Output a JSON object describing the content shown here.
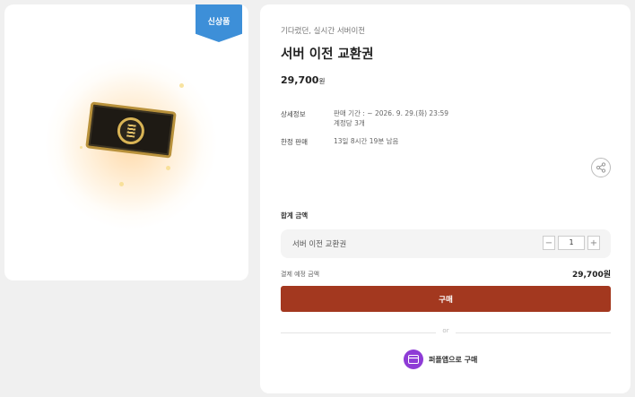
{
  "badge": {
    "label": "신상품",
    "color": "#3d8fd8"
  },
  "product": {
    "subtitle": "기다렸던, 실시간 서버이전",
    "title": "서버 이전 교환권",
    "price": "29,700",
    "currency": "원"
  },
  "details": {
    "info_label": "상세정보",
    "sale_period": "판매 기간 : ~ 2026. 9. 29.(화) 23:59",
    "account_limit": "계정당 3개",
    "limited_label": "한정 판매",
    "remaining": "13일 8시간 19분 남음"
  },
  "share_icon": "share-icon",
  "order": {
    "total_label": "합계 금액",
    "item_name": "서버 이전 교환권",
    "quantity": "1",
    "minus": "−",
    "plus": "+",
    "expected_label": "결제 예정 금액",
    "expected_price": "29,700원"
  },
  "actions": {
    "buy_label": "구매",
    "buy_color": "#a3381f",
    "or_label": "or",
    "alt_buy_label": "퍼플앱으로 구매",
    "alt_color": "#8e3bd6"
  }
}
